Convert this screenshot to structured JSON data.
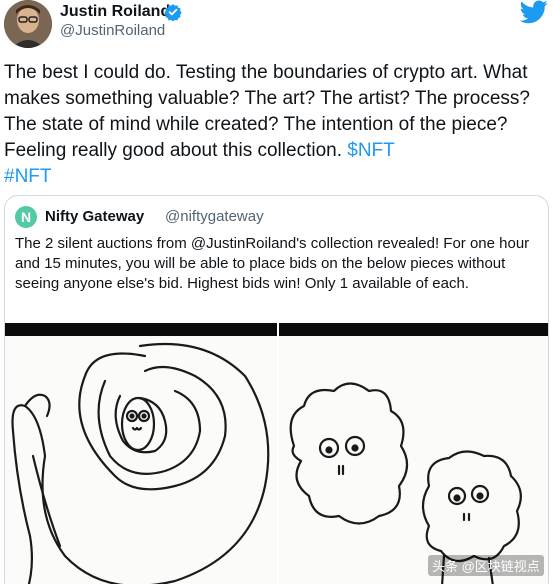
{
  "tweet": {
    "author_name": "Justin Roiland",
    "author_handle": "@JustinRoiland",
    "text": "The best I could do. Testing the boundaries of crypto art. What makes something valuable? The art? The artist? The process? The state of mind while created? The intention of the piece? Feeling really good about this collection. ",
    "cashtag": "$NFT",
    "hashtag": "#NFT"
  },
  "quote": {
    "logo_letter": "N",
    "author_name": "Nifty Gateway",
    "author_handle": "@niftygateway",
    "text": "The 2 silent auctions from @JustinRoiland's collection revealed! For one hour and 15 minutes, you will be able to place bids on the below pieces without seeing anyone else's bid. Highest bids win! Only 1 available of each."
  },
  "watermark": "头条 @区块链视点",
  "colors": {
    "link": "#1d9bf0",
    "verified": "#1d9bf0",
    "twitter": "#1d9bf0",
    "nifty_logo": "#55c9a5"
  },
  "icons": [
    "verified-badge-icon",
    "twitter-bird-icon",
    "nifty-gateway-logo-icon"
  ]
}
